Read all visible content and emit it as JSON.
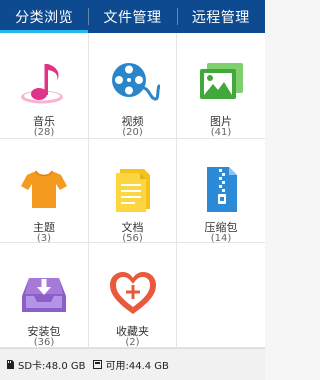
{
  "tabs": [
    {
      "label": "分类浏览"
    },
    {
      "label": "文件管理"
    },
    {
      "label": "远程管理"
    }
  ],
  "categories": [
    {
      "label": "音乐",
      "count": "(28)",
      "icon": "music-note-icon",
      "color": "#e0338a"
    },
    {
      "label": "视频",
      "count": "(20)",
      "icon": "film-reel-icon",
      "color": "#2a86c8"
    },
    {
      "label": "图片",
      "count": "(41)",
      "icon": "picture-icon",
      "color": "#43a83b"
    },
    {
      "label": "主题",
      "count": "(3)",
      "icon": "tshirt-icon",
      "color": "#f39a1f"
    },
    {
      "label": "文档",
      "count": "(56)",
      "icon": "document-icon",
      "color": "#f5c21b"
    },
    {
      "label": "压缩包",
      "count": "(14)",
      "icon": "zip-icon",
      "color": "#2d8ad6"
    },
    {
      "label": "安装包",
      "count": "(36)",
      "icon": "install-tray-icon",
      "color": "#8b5fc7"
    },
    {
      "label": "收藏夹",
      "count": "(2)",
      "icon": "heart-plus-icon",
      "color": "#e85a3b"
    }
  ],
  "status": {
    "sd_label": "SD卡:48.0 GB",
    "free_label": "可用:44.4 GB"
  },
  "colors": {
    "tab_bar": "#0e4a8f",
    "tab_indicator": "#25b7f0"
  }
}
